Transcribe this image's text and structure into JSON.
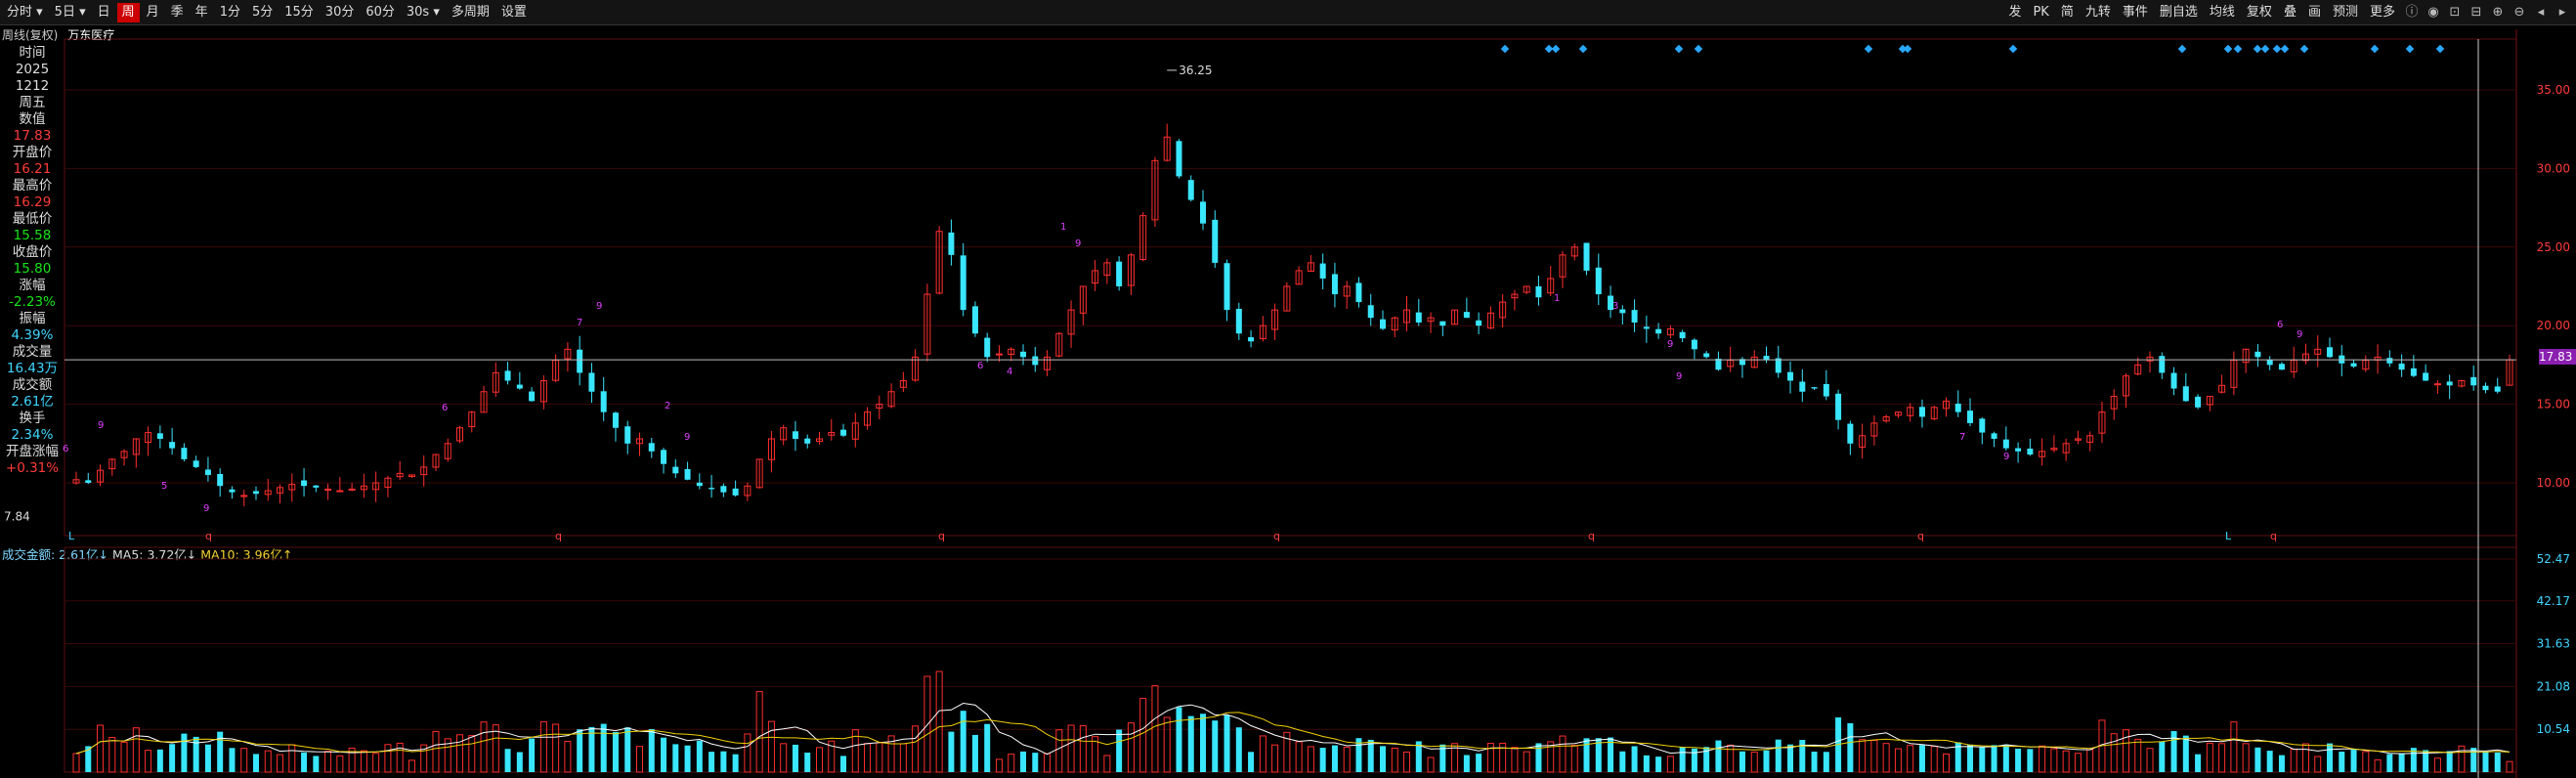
{
  "toolbar": {
    "left": [
      {
        "label": "分时",
        "icon": "chevron-down-icon"
      },
      {
        "label": "5日",
        "icon": "chevron-down-icon"
      },
      {
        "label": "日"
      },
      {
        "label": "周",
        "active": true
      },
      {
        "label": "月"
      },
      {
        "label": "季"
      },
      {
        "label": "年"
      },
      {
        "label": "1分"
      },
      {
        "label": "5分"
      },
      {
        "label": "15分"
      },
      {
        "label": "30分"
      },
      {
        "label": "60分"
      },
      {
        "label": "30s",
        "icon": "chevron-down-icon"
      },
      {
        "label": "多周期"
      },
      {
        "label": "设置"
      }
    ],
    "right": [
      "发",
      "PK",
      "简",
      "九转",
      "事件",
      "删自选",
      "均线",
      "复权",
      "叠",
      "画",
      "预测",
      "更多"
    ]
  },
  "title": {
    "period": "周线(复权)",
    "stock": "万东医疗"
  },
  "info": [
    {
      "label": "时间",
      "value": "2025"
    },
    {
      "label": "",
      "value": "1212"
    },
    {
      "label": "",
      "value": "周五"
    },
    {
      "label": "数值",
      "value": "17.83",
      "color": "red"
    },
    {
      "label": "开盘价",
      "value": "16.21",
      "color": "red"
    },
    {
      "label": "最高价",
      "value": "16.29",
      "color": "red"
    },
    {
      "label": "最低价",
      "value": "15.58",
      "color": "green"
    },
    {
      "label": "收盘价",
      "value": "15.80",
      "color": "green"
    },
    {
      "label": "涨幅",
      "value": "-2.23%",
      "color": "green"
    },
    {
      "label": "振幅",
      "value": "4.39%",
      "color": "cyan"
    },
    {
      "label": "成交量",
      "value": "16.43万",
      "color": "cyan"
    },
    {
      "label": "成交额",
      "value": "2.61亿",
      "color": "cyan"
    },
    {
      "label": "换手",
      "value": "2.34%",
      "color": "cyan"
    },
    {
      "label": "开盘涨幅",
      "value": "+0.31%",
      "color": "red"
    }
  ],
  "price_axis": [
    "35.00",
    "30.00",
    "25.00",
    "20.00",
    "15.00",
    "10.00"
  ],
  "current_price": "17.83",
  "max_label": "36.25",
  "min_label": "7.84",
  "volume_legend": {
    "label": "成交金额: 2.61亿↓",
    "ma5": "MA5: 3.72亿↓",
    "ma10": "MA10: 3.96亿↑"
  },
  "volume_axis": [
    "52.47",
    "42.17",
    "31.63",
    "21.08",
    "10.54"
  ],
  "colors": {
    "up": "#ff2e2e",
    "down": "#39e6ff",
    "ma5": "#ffffff",
    "ma10": "#f0d000",
    "marker": "#2aa8ff",
    "td": "#e040ff",
    "crosshair": "#cccccc"
  },
  "chart_data": {
    "type": "candlestick",
    "period": "weekly",
    "ylim": [
      7.84,
      36.25
    ],
    "volume_ylim_yi": [
      0,
      52.47
    ],
    "last_bar": {
      "open": 16.21,
      "high": 16.29,
      "low": 15.58,
      "close": 15.8,
      "amount_yi": 2.61,
      "volume_wan": 16.43,
      "turnover_pct": 2.34
    },
    "peak": 36.25,
    "trough": 7.84,
    "closes_approx": [
      10.2,
      10.0,
      10.8,
      11.5,
      12.0,
      12.8,
      13.2,
      12.8,
      12.2,
      11.5,
      11.0,
      10.5,
      9.8,
      9.4,
      9.2,
      9.3,
      9.5,
      9.7,
      9.9,
      9.8,
      9.7,
      9.6,
      9.5,
      9.6,
      9.8,
      10.0,
      10.3,
      10.6,
      10.5,
      11.0,
      11.8,
      12.5,
      13.5,
      14.5,
      15.8,
      17.0,
      16.5,
      16.0,
      15.2,
      16.5,
      17.8,
      18.5,
      17.0,
      15.8,
      14.5,
      13.5,
      12.5,
      12.8,
      12.0,
      11.2,
      10.6,
      10.2,
      9.8,
      9.6,
      9.4,
      9.2,
      9.8,
      11.5,
      12.8,
      13.5,
      12.8,
      12.5,
      12.8,
      13.2,
      13.0,
      13.8,
      14.5,
      15.0,
      15.8,
      16.5,
      18.0,
      22.0,
      26.0,
      24.5,
      21.0,
      19.5,
      18.0,
      18.2,
      18.5,
      18.0,
      17.5,
      18.0,
      19.5,
      21.0,
      22.5,
      23.5,
      24.0,
      22.5,
      24.5,
      27.0,
      30.5,
      32.0,
      29.5,
      28.0,
      26.5,
      24.0,
      21.0,
      19.5,
      19.0,
      20.0,
      21.0,
      22.5,
      23.5,
      24.0,
      23.0,
      22.0,
      22.5,
      21.5,
      20.5,
      19.8,
      20.5,
      21.0,
      20.2,
      20.5,
      20.0,
      21.0,
      20.5,
      20.0,
      20.8,
      21.5,
      22.0,
      22.5,
      21.8,
      23.0,
      24.5,
      25.0,
      23.5,
      22.0,
      21.0,
      20.8,
      20.2,
      19.8,
      19.5,
      19.8,
      19.2,
      18.5,
      18.0,
      17.2,
      17.8,
      17.5,
      18.0,
      17.8,
      17.0,
      16.5,
      15.8,
      16.0,
      15.5,
      14.0,
      12.5,
      13.0,
      13.8,
      14.2,
      14.5,
      14.8,
      14.2,
      14.8,
      15.2,
      14.5,
      13.8,
      13.2,
      12.8,
      12.2,
      12.0,
      11.8,
      12.0,
      12.2,
      12.5,
      12.8,
      13.0,
      14.5,
      15.5,
      16.8,
      17.5,
      18.0,
      17.0,
      16.0,
      15.2,
      14.8,
      15.5,
      16.2,
      17.8,
      18.5,
      18.0,
      17.5,
      17.2,
      17.8,
      18.2,
      18.5,
      18.0,
      17.6,
      17.4,
      17.8,
      18.0,
      17.6,
      17.2,
      16.8,
      16.5,
      16.3,
      16.2,
      16.5,
      16.2,
      15.9,
      15.8,
      17.83
    ]
  }
}
